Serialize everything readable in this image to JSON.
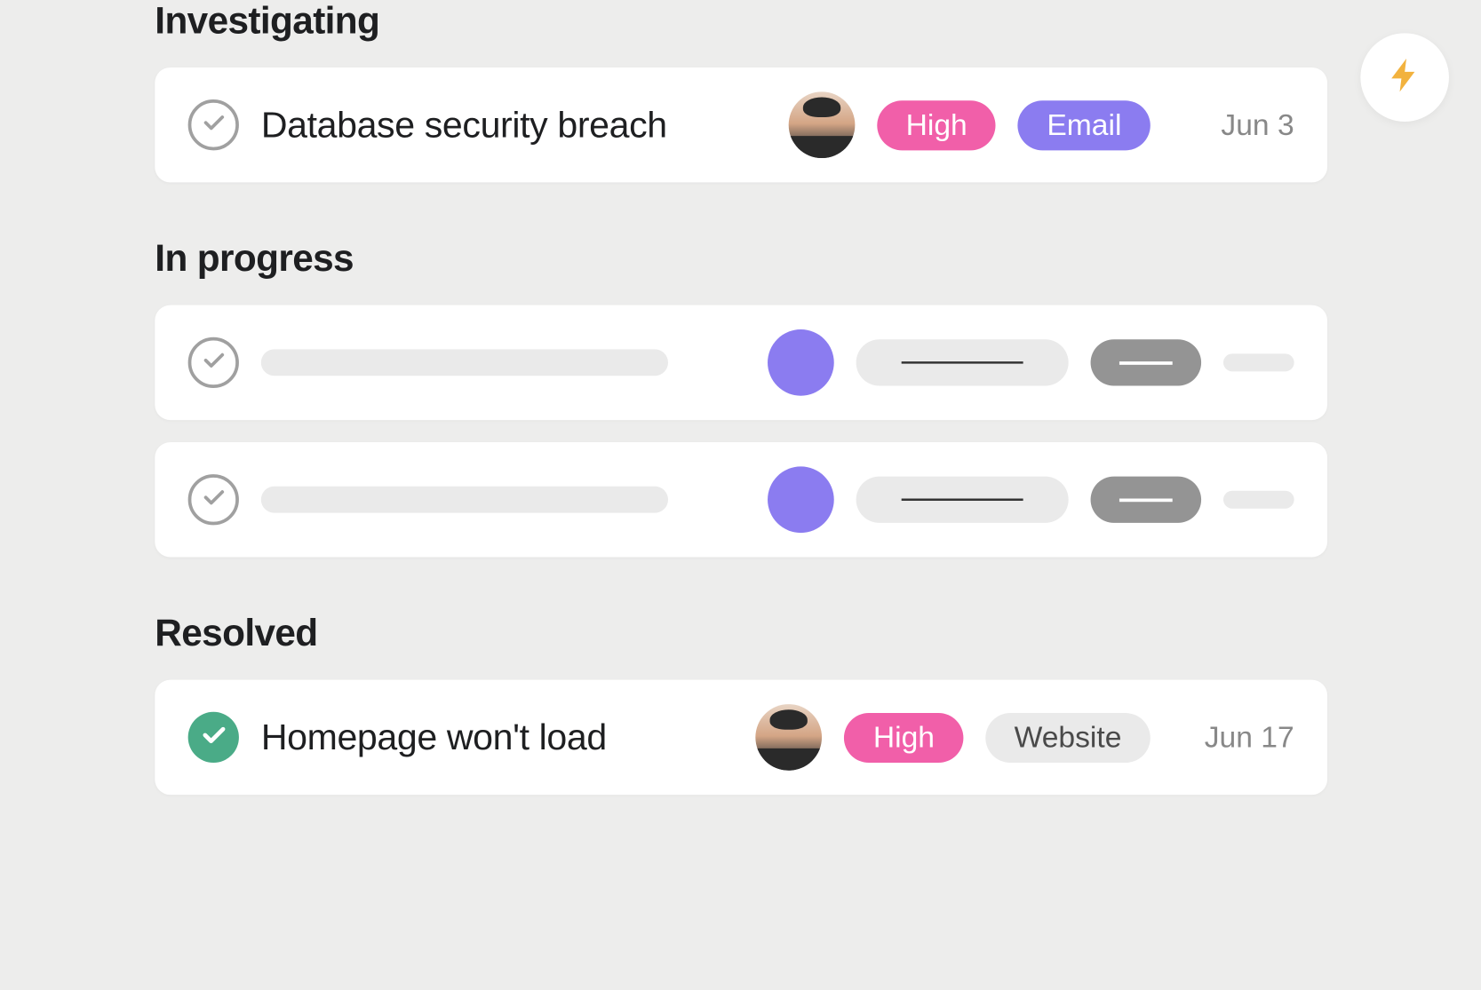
{
  "sections": {
    "investigating": {
      "title": "Investigating",
      "task": {
        "title": "Database security breach",
        "completed": false,
        "priority": {
          "label": "High",
          "color": "#f15fa9"
        },
        "source": {
          "label": "Email",
          "color": "#8b7cf0"
        },
        "date": "Jun 3"
      }
    },
    "in_progress": {
      "title": "In progress"
    },
    "resolved": {
      "title": "Resolved",
      "task": {
        "title": "Homepage won't load",
        "completed": true,
        "priority": {
          "label": "High",
          "color": "#f15fa9"
        },
        "source": {
          "label": "Website",
          "color": "#eaeaea"
        },
        "date": "Jun 17"
      }
    }
  },
  "icons": {
    "lightning": "lightning-icon",
    "check": "check-icon"
  },
  "colors": {
    "pink": "#f15fa9",
    "purple": "#8b7cf0",
    "green": "#4aab87",
    "gray_pill": "#eaeaea",
    "gray_solid": "#949494",
    "text_muted": "#888888",
    "background": "#ededec"
  }
}
